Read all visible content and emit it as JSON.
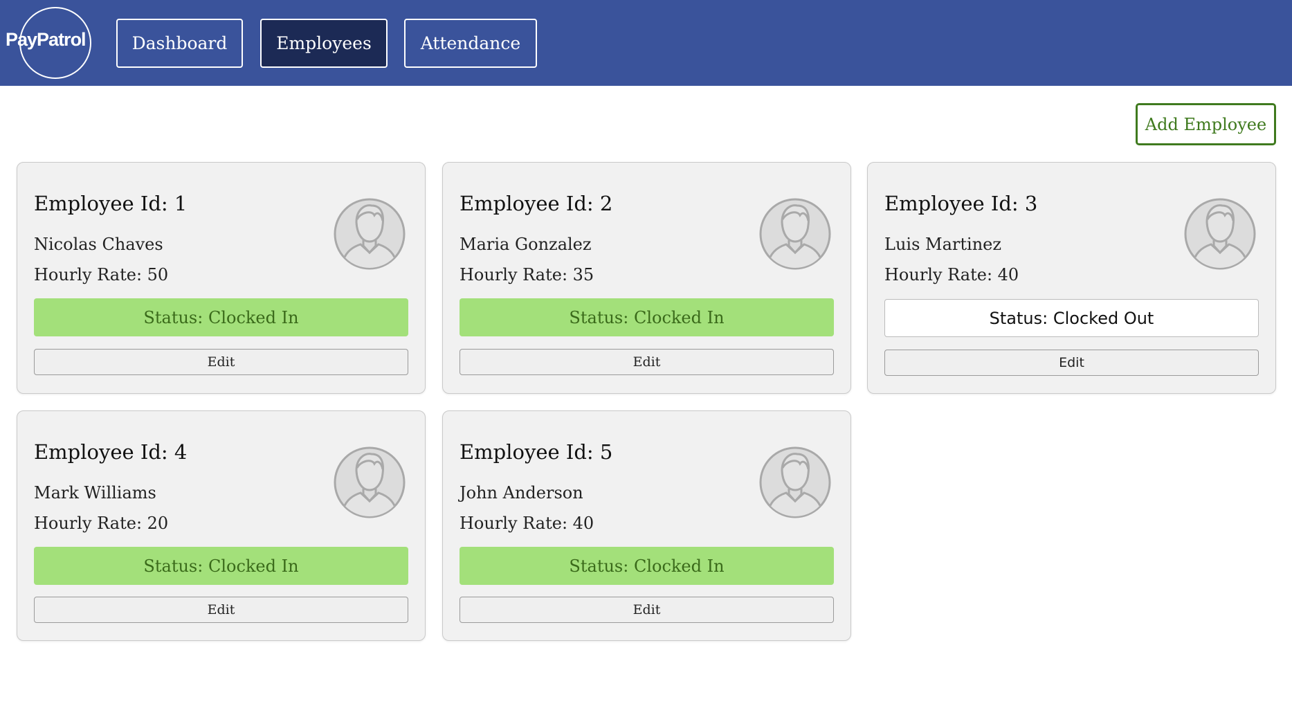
{
  "header": {
    "logo_text": "PayPatrol",
    "nav": {
      "dashboard": "Dashboard",
      "employees": "Employees",
      "attendance": "Attendance"
    },
    "active_tab": "Employees",
    "colors": {
      "header_bg": "#3a539b",
      "active_tab_bg": "#1c2a55"
    }
  },
  "toolbar": {
    "add_employee_label": "Add Employee"
  },
  "employees": [
    {
      "id_label": "Employee Id: 1",
      "name": "Nicolas Chaves",
      "rate_label": "Hourly Rate: 50",
      "status_label": "Status: Clocked In",
      "status": "in",
      "edit_label": "Edit",
      "avatar_icon": "user-avatar-icon"
    },
    {
      "id_label": "Employee Id: 2",
      "name": "Maria Gonzalez",
      "rate_label": "Hourly Rate: 35",
      "status_label": "Status: Clocked In",
      "status": "in",
      "edit_label": "Edit",
      "avatar_icon": "user-avatar-icon"
    },
    {
      "id_label": "Employee Id: 3",
      "name": "Luis Martinez",
      "rate_label": "Hourly Rate: 40",
      "status_label": "Status: Clocked Out",
      "status": "out",
      "edit_label": "Edit",
      "avatar_icon": "user-avatar-icon"
    },
    {
      "id_label": "Employee Id: 4",
      "name": "Mark Williams",
      "rate_label": "Hourly Rate: 20",
      "status_label": "Status: Clocked In",
      "status": "in",
      "edit_label": "Edit",
      "avatar_icon": "user-avatar-icon"
    },
    {
      "id_label": "Employee Id: 5",
      "name": "John Anderson",
      "rate_label": "Hourly Rate: 40",
      "status_label": "Status: Clocked In",
      "status": "in",
      "edit_label": "Edit",
      "avatar_icon": "user-avatar-icon"
    }
  ],
  "colors": {
    "clocked_in_bg": "#a3e07a",
    "clocked_in_text": "#3a6a1a",
    "add_button": "#3f7a1e",
    "card_bg": "#f1f1f1"
  }
}
